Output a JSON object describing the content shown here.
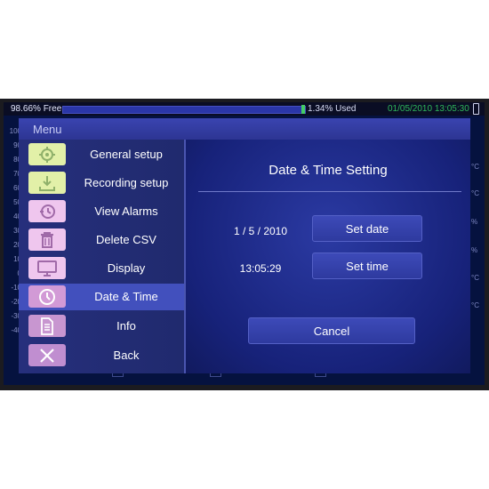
{
  "status_bar": {
    "free_text": "98.66% Free",
    "used_text": "1.34% Used",
    "datetime": "01/05/2010 13:05:30",
    "colors": {
      "datetime": "#2fb75a",
      "used_marker": "#44cc66"
    }
  },
  "background": {
    "y_ticks": [
      "100",
      "90",
      "80",
      "70",
      "60",
      "50",
      "40",
      "30",
      "20",
      "10",
      "0",
      "-10",
      "-20",
      "-30",
      "-40"
    ],
    "right_units": [
      "°C",
      "°C",
      "%",
      "%",
      "°C",
      "°C"
    ]
  },
  "menu": {
    "title": "Menu",
    "items": [
      {
        "label": "General setup",
        "icon": "gear-icon",
        "color": "#e2f0a8"
      },
      {
        "label": "Recording setup",
        "icon": "download-icon",
        "color": "#e2f0a8"
      },
      {
        "label": "View Alarms",
        "icon": "history-clock-icon",
        "color": "#efc6ee"
      },
      {
        "label": "Delete CSV",
        "icon": "trash-icon",
        "color": "#efc6ee"
      },
      {
        "label": "Display",
        "icon": "monitor-icon",
        "color": "#efc6ee"
      },
      {
        "label": "Date & Time",
        "icon": "clock-icon",
        "color": "#d29ad6",
        "active": true
      },
      {
        "label": "Info",
        "icon": "document-icon",
        "color": "#c896d0"
      },
      {
        "label": "Back",
        "icon": "close-x-icon",
        "color": "#c08ed0"
      }
    ]
  },
  "panel": {
    "title": "Date & Time Setting",
    "date_value": "1 / 5 / 2010",
    "time_value": "13:05:29",
    "set_date_label": "Set date",
    "set_time_label": "Set time",
    "cancel_label": "Cancel"
  },
  "colors": {
    "accent": "#4250bd",
    "panel_bg": "#17227a",
    "button": "#3d4ab8"
  }
}
